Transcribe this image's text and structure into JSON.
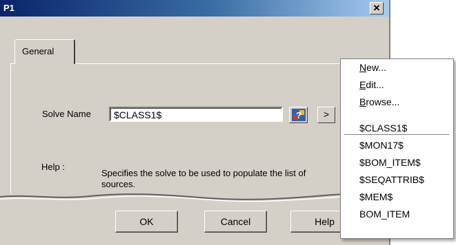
{
  "window": {
    "title": "P1",
    "close_glyph": "✕"
  },
  "tabs": [
    {
      "label": "General"
    }
  ],
  "form": {
    "solve_name_label": "Solve Name",
    "solve_name_value": "$CLASS1$",
    "browse_icon": "solve-browse-icon",
    "arrow_label": ">",
    "help_label": "Help :",
    "help_text": "Specifies the solve to be used to populate the list of sources."
  },
  "buttons": {
    "ok": "OK",
    "cancel": "Cancel",
    "help": "Help"
  },
  "context_menu": {
    "actions": [
      {
        "accel": "N",
        "rest": "ew..."
      },
      {
        "accel": "E",
        "rest": "dit..."
      },
      {
        "accel": "B",
        "rest": "rowse..."
      }
    ],
    "items": [
      "$CLASS1$",
      "$MON17$",
      "$BOM_ITEM$",
      "$SEQATTRIB$",
      "$MEM$",
      "BOM_ITEM"
    ]
  },
  "colors": {
    "titlebar_start": "#0a246a",
    "titlebar_end": "#a6caf0",
    "face": "#d4d0c8"
  }
}
